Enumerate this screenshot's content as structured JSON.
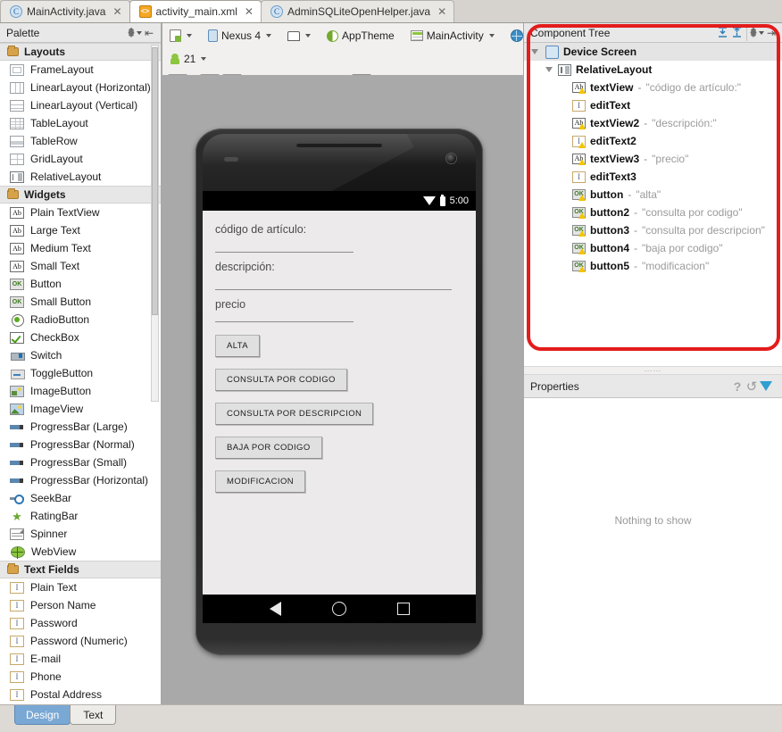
{
  "window": {
    "editor_tabs": [
      {
        "label": "MainActivity.java",
        "icon": "java-class-icon",
        "glyph": "C",
        "active": false,
        "closable": true
      },
      {
        "label": "activity_main.xml",
        "icon": "xml-layout-icon",
        "glyph": "<>",
        "active": true,
        "closable": true
      },
      {
        "label": "AdminSQLiteOpenHelper.java",
        "icon": "java-class-icon",
        "glyph": "C",
        "active": false,
        "closable": true
      }
    ]
  },
  "palette": {
    "title": "Palette",
    "header_icons": [
      "gear-icon",
      "collapse-panel-icon"
    ],
    "groups": [
      {
        "name": "Layouts",
        "items": [
          {
            "label": "FrameLayout",
            "icon": "frame-layout-icon",
            "shape": "i-frame"
          },
          {
            "label": "LinearLayout (Horizontal)",
            "icon": "linear-layout-horizontal-icon",
            "shape": "i-linh"
          },
          {
            "label": "LinearLayout (Vertical)",
            "icon": "linear-layout-vertical-icon",
            "shape": "i-linv"
          },
          {
            "label": "TableLayout",
            "icon": "table-layout-icon",
            "shape": "i-table"
          },
          {
            "label": "TableRow",
            "icon": "table-row-icon",
            "shape": "i-trow"
          },
          {
            "label": "GridLayout",
            "icon": "grid-layout-icon",
            "shape": "i-grid"
          },
          {
            "label": "RelativeLayout",
            "icon": "relative-layout-icon",
            "shape": "i-rel"
          }
        ]
      },
      {
        "name": "Widgets",
        "items": [
          {
            "label": "Plain TextView",
            "icon": "textview-icon",
            "shape": "i-ab",
            "glyph": "Ab"
          },
          {
            "label": "Large Text",
            "icon": "textview-large-icon",
            "shape": "i-ab",
            "glyph": "Ab"
          },
          {
            "label": "Medium Text",
            "icon": "textview-medium-icon",
            "shape": "i-ab",
            "glyph": "Ab"
          },
          {
            "label": "Small Text",
            "icon": "textview-small-icon",
            "shape": "i-ab",
            "glyph": "Ab"
          },
          {
            "label": "Button",
            "icon": "button-icon",
            "shape": "i-ok",
            "glyph": "OK"
          },
          {
            "label": "Small Button",
            "icon": "small-button-icon",
            "shape": "i-ok",
            "glyph": "OK"
          },
          {
            "label": "RadioButton",
            "icon": "radio-button-icon",
            "shape": "i-radio"
          },
          {
            "label": "CheckBox",
            "icon": "checkbox-icon",
            "shape": "i-check"
          },
          {
            "label": "Switch",
            "icon": "switch-icon",
            "shape": "i-switch"
          },
          {
            "label": "ToggleButton",
            "icon": "toggle-button-icon",
            "shape": "i-toggle"
          },
          {
            "label": "ImageButton",
            "icon": "image-button-icon",
            "shape": "i-imgbtn"
          },
          {
            "label": "ImageView",
            "icon": "image-view-icon",
            "shape": "i-imgview"
          },
          {
            "label": "ProgressBar (Large)",
            "icon": "progressbar-large-icon",
            "shape": "i-prog"
          },
          {
            "label": "ProgressBar (Normal)",
            "icon": "progressbar-normal-icon",
            "shape": "i-prog"
          },
          {
            "label": "ProgressBar (Small)",
            "icon": "progressbar-small-icon",
            "shape": "i-prog"
          },
          {
            "label": "ProgressBar (Horizontal)",
            "icon": "progressbar-horizontal-icon",
            "shape": "i-prog"
          },
          {
            "label": "SeekBar",
            "icon": "seekbar-icon",
            "shape": "i-seek"
          },
          {
            "label": "RatingBar",
            "icon": "ratingbar-icon",
            "shape": "i-rating",
            "glyph": "★"
          },
          {
            "label": "Spinner",
            "icon": "spinner-icon",
            "shape": "i-spinner"
          },
          {
            "label": "WebView",
            "icon": "webview-icon",
            "shape": "i-web"
          }
        ]
      },
      {
        "name": "Text Fields",
        "items": [
          {
            "label": "Plain Text",
            "icon": "edittext-plain-icon",
            "shape": "i-text",
            "glyph": "I"
          },
          {
            "label": "Person Name",
            "icon": "edittext-person-name-icon",
            "shape": "i-text",
            "glyph": "I"
          },
          {
            "label": "Password",
            "icon": "edittext-password-icon",
            "shape": "i-text",
            "glyph": "I"
          },
          {
            "label": "Password (Numeric)",
            "icon": "edittext-password-numeric-icon",
            "shape": "i-text",
            "glyph": "I"
          },
          {
            "label": "E-mail",
            "icon": "edittext-email-icon",
            "shape": "i-text",
            "glyph": "I"
          },
          {
            "label": "Phone",
            "icon": "edittext-phone-icon",
            "shape": "i-text",
            "glyph": "I"
          },
          {
            "label": "Postal Address",
            "icon": "edittext-postal-address-icon",
            "shape": "i-text",
            "glyph": "I"
          }
        ]
      }
    ]
  },
  "editor_toolbar": {
    "device_menu": "",
    "device_name": "Nexus 4",
    "orientation": "",
    "theme": "AppTheme",
    "activity": "MainActivity",
    "locale": "",
    "api_level": "21",
    "zoom_buttons": [
      "zoom-fit-icon",
      "zoom-actual-icon",
      "zoom-in-icon",
      "zoom-out-icon",
      "render-icon",
      "refresh-icon",
      "config-gear-icon"
    ],
    "view_buttons": [
      "fit-selection-icon",
      "fit-width-icon",
      "fit-height-icon"
    ]
  },
  "preview": {
    "status_bar": {
      "time": "5:00",
      "wifi": "wifi-icon",
      "battery": "battery-icon"
    },
    "fields": [
      {
        "label": "código de artículo:",
        "has_input": true
      },
      {
        "label": "descripción:",
        "has_input": true
      },
      {
        "label": "precio",
        "has_input": true
      }
    ],
    "buttons": [
      "ALTA",
      "CONSULTA POR CODIGO",
      "CONSULTA POR DESCRIPCION",
      "BAJA POR CODIGO",
      "MODIFICACION"
    ],
    "nav": [
      "back-icon",
      "home-icon",
      "recents-icon"
    ]
  },
  "component_tree": {
    "title": "Component Tree",
    "header_icons": [
      "expand-all-icon",
      "collapse-all-icon",
      "gear-icon",
      "minimize-panel-icon"
    ],
    "nodes": [
      {
        "name": "Device Screen",
        "value": "",
        "depth": 0,
        "icon": "device-screen-icon",
        "shape": "t-screen",
        "expanded": true,
        "selected": true,
        "warn": false
      },
      {
        "name": "RelativeLayout",
        "value": "",
        "depth": 1,
        "icon": "relative-layout-icon",
        "shape": "t-rel",
        "expanded": true,
        "selected": false,
        "warn": false
      },
      {
        "name": "textView",
        "value": "\"código de artículo:\"",
        "depth": 2,
        "icon": "textview-icon",
        "shape": "t-ab",
        "glyph": "Ab",
        "warn": true
      },
      {
        "name": "editText",
        "value": "",
        "depth": 2,
        "icon": "edittext-icon",
        "shape": "t-ed",
        "glyph": "I",
        "warn": false
      },
      {
        "name": "textView2",
        "value": "\"descripción:\"",
        "depth": 2,
        "icon": "textview-icon",
        "shape": "t-ab",
        "glyph": "Ab",
        "warn": true
      },
      {
        "name": "editText2",
        "value": "",
        "depth": 2,
        "icon": "edittext-icon",
        "shape": "t-ed",
        "glyph": "I",
        "warn": true
      },
      {
        "name": "textView3",
        "value": "\"precio\"",
        "depth": 2,
        "icon": "textview-icon",
        "shape": "t-ab",
        "glyph": "Ab",
        "warn": true
      },
      {
        "name": "editText3",
        "value": "",
        "depth": 2,
        "icon": "edittext-icon",
        "shape": "t-ed",
        "glyph": "I",
        "warn": false
      },
      {
        "name": "button",
        "value": "\"alta\"",
        "depth": 2,
        "icon": "button-icon",
        "shape": "t-btn",
        "glyph": "OK",
        "warn": true
      },
      {
        "name": "button2",
        "value": "\"consulta por codigo\"",
        "depth": 2,
        "icon": "button-icon",
        "shape": "t-btn",
        "glyph": "OK",
        "warn": true
      },
      {
        "name": "button3",
        "value": "\"consulta por descripcion\"",
        "depth": 2,
        "icon": "button-icon",
        "shape": "t-btn",
        "glyph": "OK",
        "warn": true
      },
      {
        "name": "button4",
        "value": "\"baja por codigo\"",
        "depth": 2,
        "icon": "button-icon",
        "shape": "t-btn",
        "glyph": "OK",
        "warn": true
      },
      {
        "name": "button5",
        "value": "\"modificacion\"",
        "depth": 2,
        "icon": "button-icon",
        "shape": "t-btn",
        "glyph": "OK",
        "warn": true
      }
    ]
  },
  "properties": {
    "title": "Properties",
    "header_icons": [
      "help-icon",
      "undo-icon",
      "filter-icon"
    ],
    "empty_message": "Nothing to show"
  },
  "bottom_tabs": [
    {
      "label": "Design",
      "active": true
    },
    {
      "label": "Text",
      "active": false
    }
  ],
  "colors": {
    "accent_blue": "#7aa8d4",
    "annotation_red": "#e31c1c",
    "panel_bg": "#e8e8e8",
    "canvas_bg": "#a9a9a9"
  }
}
